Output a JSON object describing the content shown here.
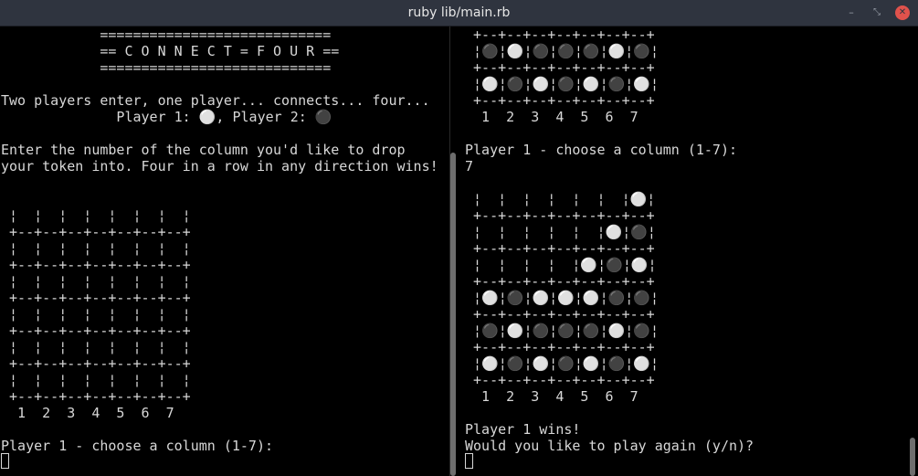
{
  "window": {
    "title": "ruby lib/main.rb",
    "buttons": {
      "minimize": "–",
      "maximize": "⤡",
      "close": "✕"
    }
  },
  "left_pane": {
    "lines": [
      "            ============================",
      "            == C O N N E C T = F O U R ==",
      "            ============================",
      "",
      "Two players enter, one player... connects... four...",
      "              Player 1: ⚪, Player 2: ⚫",
      "",
      "Enter the number of the column you'd like to drop",
      "your token into. Four in a row in any direction wins!",
      "",
      "",
      " ¦  ¦  ¦  ¦  ¦  ¦  ¦  ¦",
      " +--+--+--+--+--+--+--+",
      " ¦  ¦  ¦  ¦  ¦  ¦  ¦  ¦",
      " +--+--+--+--+--+--+--+",
      " ¦  ¦  ¦  ¦  ¦  ¦  ¦  ¦",
      " +--+--+--+--+--+--+--+",
      " ¦  ¦  ¦  ¦  ¦  ¦  ¦  ¦",
      " +--+--+--+--+--+--+--+",
      " ¦  ¦  ¦  ¦  ¦  ¦  ¦  ¦",
      " +--+--+--+--+--+--+--+",
      " ¦  ¦  ¦  ¦  ¦  ¦  ¦  ¦",
      " +--+--+--+--+--+--+--+",
      "  1  2  3  4  5  6  7",
      "",
      "Player 1 - choose a column (1-7):"
    ]
  },
  "right_pane": {
    "lines": [
      " +--+--+--+--+--+--+--+",
      " ¦⚫¦⚪¦⚫¦⚫¦⚫¦⚪¦⚫¦",
      " +--+--+--+--+--+--+--+",
      " ¦⚪¦⚫¦⚪¦⚫¦⚪¦⚫¦⚪¦",
      " +--+--+--+--+--+--+--+",
      "  1  2  3  4  5  6  7",
      "",
      "Player 1 - choose a column (1-7):",
      "7",
      "",
      " ¦  ¦  ¦  ¦  ¦  ¦  ¦⚪¦",
      " +--+--+--+--+--+--+--+",
      " ¦  ¦  ¦  ¦  ¦  ¦⚪¦⚫¦",
      " +--+--+--+--+--+--+--+",
      " ¦  ¦  ¦  ¦  ¦⚪¦⚫¦⚪¦",
      " +--+--+--+--+--+--+--+",
      " ¦⚪¦⚫¦⚪¦⚪¦⚪¦⚫¦⚫¦",
      " +--+--+--+--+--+--+--+",
      " ¦⚫¦⚪¦⚫¦⚫¦⚫¦⚪¦⚫¦",
      " +--+--+--+--+--+--+--+",
      " ¦⚪¦⚫¦⚪¦⚫¦⚪¦⚫¦⚪¦",
      " +--+--+--+--+--+--+--+",
      "  1  2  3  4  5  6  7",
      "",
      "Player 1 wins!",
      "Would you like to play again (y/n)?"
    ]
  },
  "colors": {
    "background": "#000000",
    "foreground": "#d8d8d8",
    "titlebar": "#2f343f",
    "close_button": "#e0524c"
  }
}
